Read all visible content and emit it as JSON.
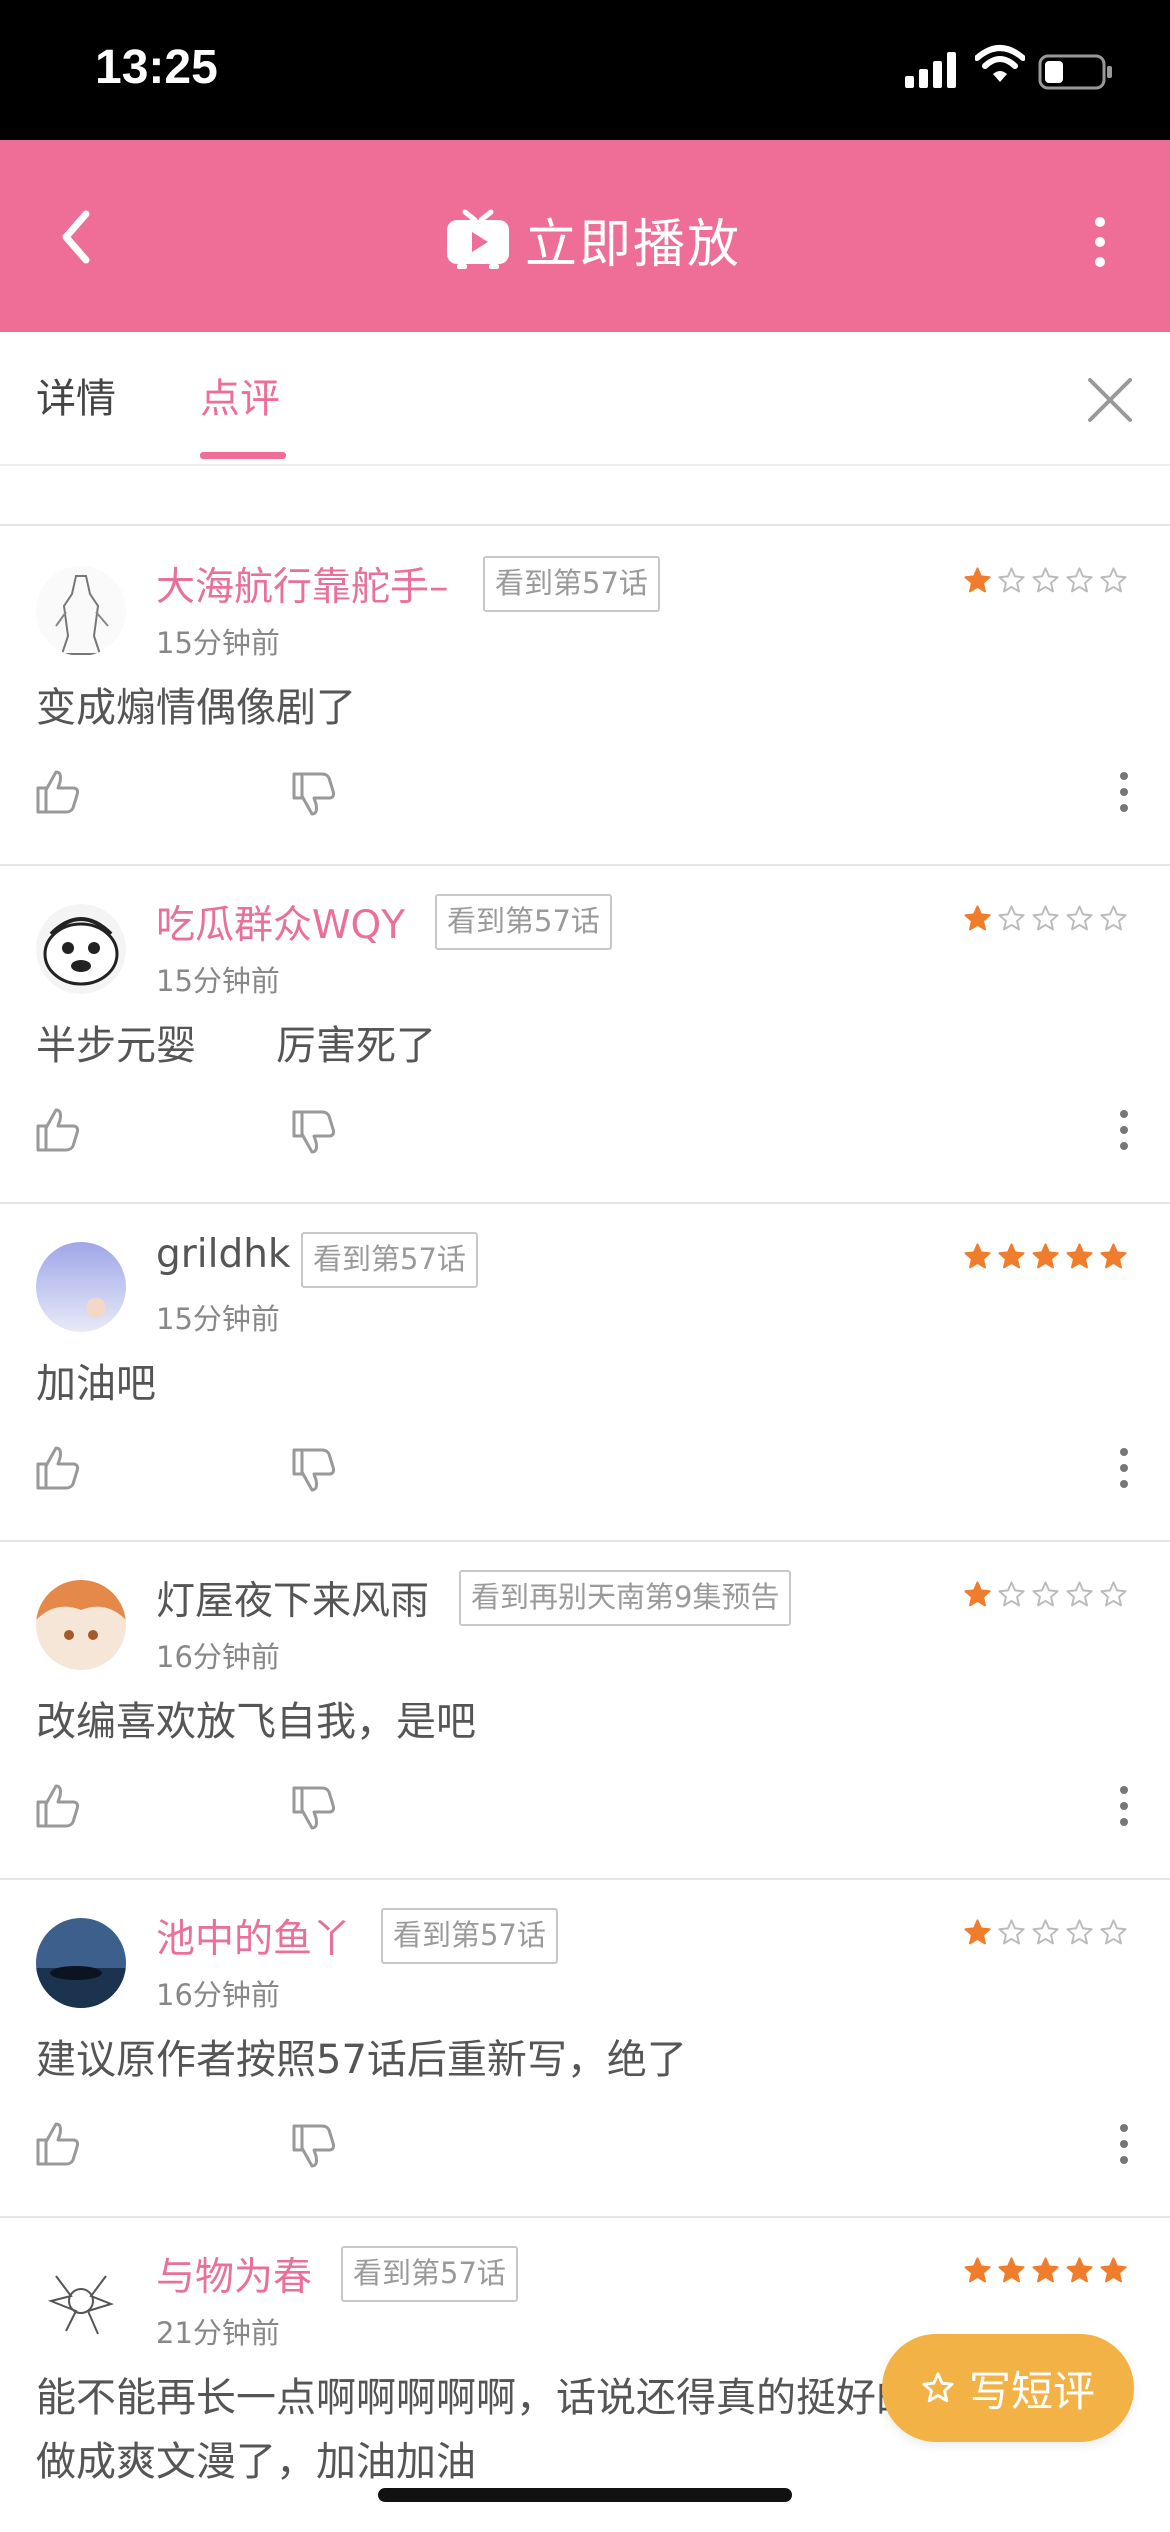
{
  "status_bar": {
    "time": "13:25"
  },
  "header": {
    "title": "立即播放"
  },
  "tabs": [
    {
      "label": "详情"
    },
    {
      "label": "点评"
    }
  ],
  "colors": {
    "accent": "#ee6e97",
    "star": "#ef7d2c",
    "fab": "#f2b245"
  },
  "comments": [
    {
      "user": "大海航行靠舵手–",
      "badge": "看到第57话",
      "time": "15分钟前",
      "text": "变成煽情偶像剧了",
      "rating": 1
    },
    {
      "user": "吃瓜群众WQY",
      "badge": "看到第57话",
      "time": "15分钟前",
      "text": "半步元婴　　厉害死了",
      "rating": 1
    },
    {
      "user": "grildhk",
      "badge": "看到第57话",
      "time": "15分钟前",
      "text": "加油吧",
      "rating": 5
    },
    {
      "user": "灯屋夜下来风雨",
      "badge": "看到再别天南第9集预告",
      "time": "16分钟前",
      "text": "改编喜欢放飞自我，是吧",
      "rating": 1
    },
    {
      "user": "池中的鱼丫",
      "badge": "看到第57话",
      "time": "16分钟前",
      "text": "建议原作者按照57话后重新写，绝了",
      "rating": 1
    },
    {
      "user": "与物为春",
      "badge": "看到第57话",
      "time": "21分钟前",
      "text": "能不能再长一点啊啊啊啊啊，话说还得真的挺好的",
      "text2": "做成爽文漫了，加油加油",
      "rating": 5
    }
  ],
  "fab": {
    "label": "写短评",
    "icon": "star-outline-icon"
  }
}
